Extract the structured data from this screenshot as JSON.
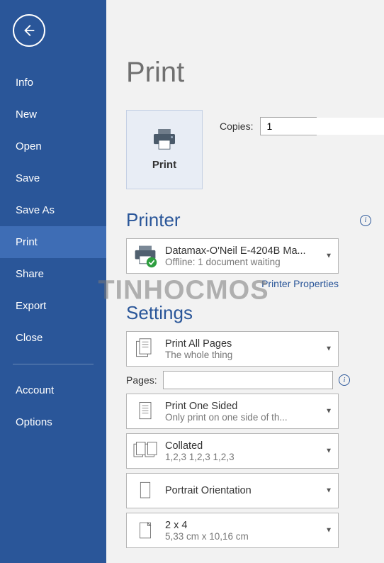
{
  "sidebar": {
    "items": [
      "Info",
      "New",
      "Open",
      "Save",
      "Save As",
      "Print",
      "Share",
      "Export",
      "Close"
    ],
    "secondary": [
      "Account",
      "Options"
    ],
    "selected_index": 5
  },
  "page": {
    "title": "Print"
  },
  "print_button": {
    "label": "Print"
  },
  "copies": {
    "label": "Copies:",
    "value": "1"
  },
  "printer_section": {
    "heading": "Printer"
  },
  "printer": {
    "name": "Datamax-O'Neil E-4204B Ma...",
    "status": "Offline: 1 document waiting",
    "properties_link": "Printer Properties"
  },
  "settings_section": {
    "heading": "Settings"
  },
  "settings": {
    "print_what": {
      "title": "Print All Pages",
      "sub": "The whole thing"
    },
    "pages_label": "Pages:",
    "pages_value": "",
    "sides": {
      "title": "Print One Sided",
      "sub": "Only print on one side of th..."
    },
    "collate": {
      "title": "Collated",
      "sub": "1,2,3    1,2,3    1,2,3"
    },
    "orientation": {
      "title": "Portrait Orientation"
    },
    "paper": {
      "title": "2 x 4",
      "sub": "5,33 cm x 10,16 cm"
    }
  },
  "watermark": "TINHOCMOS"
}
